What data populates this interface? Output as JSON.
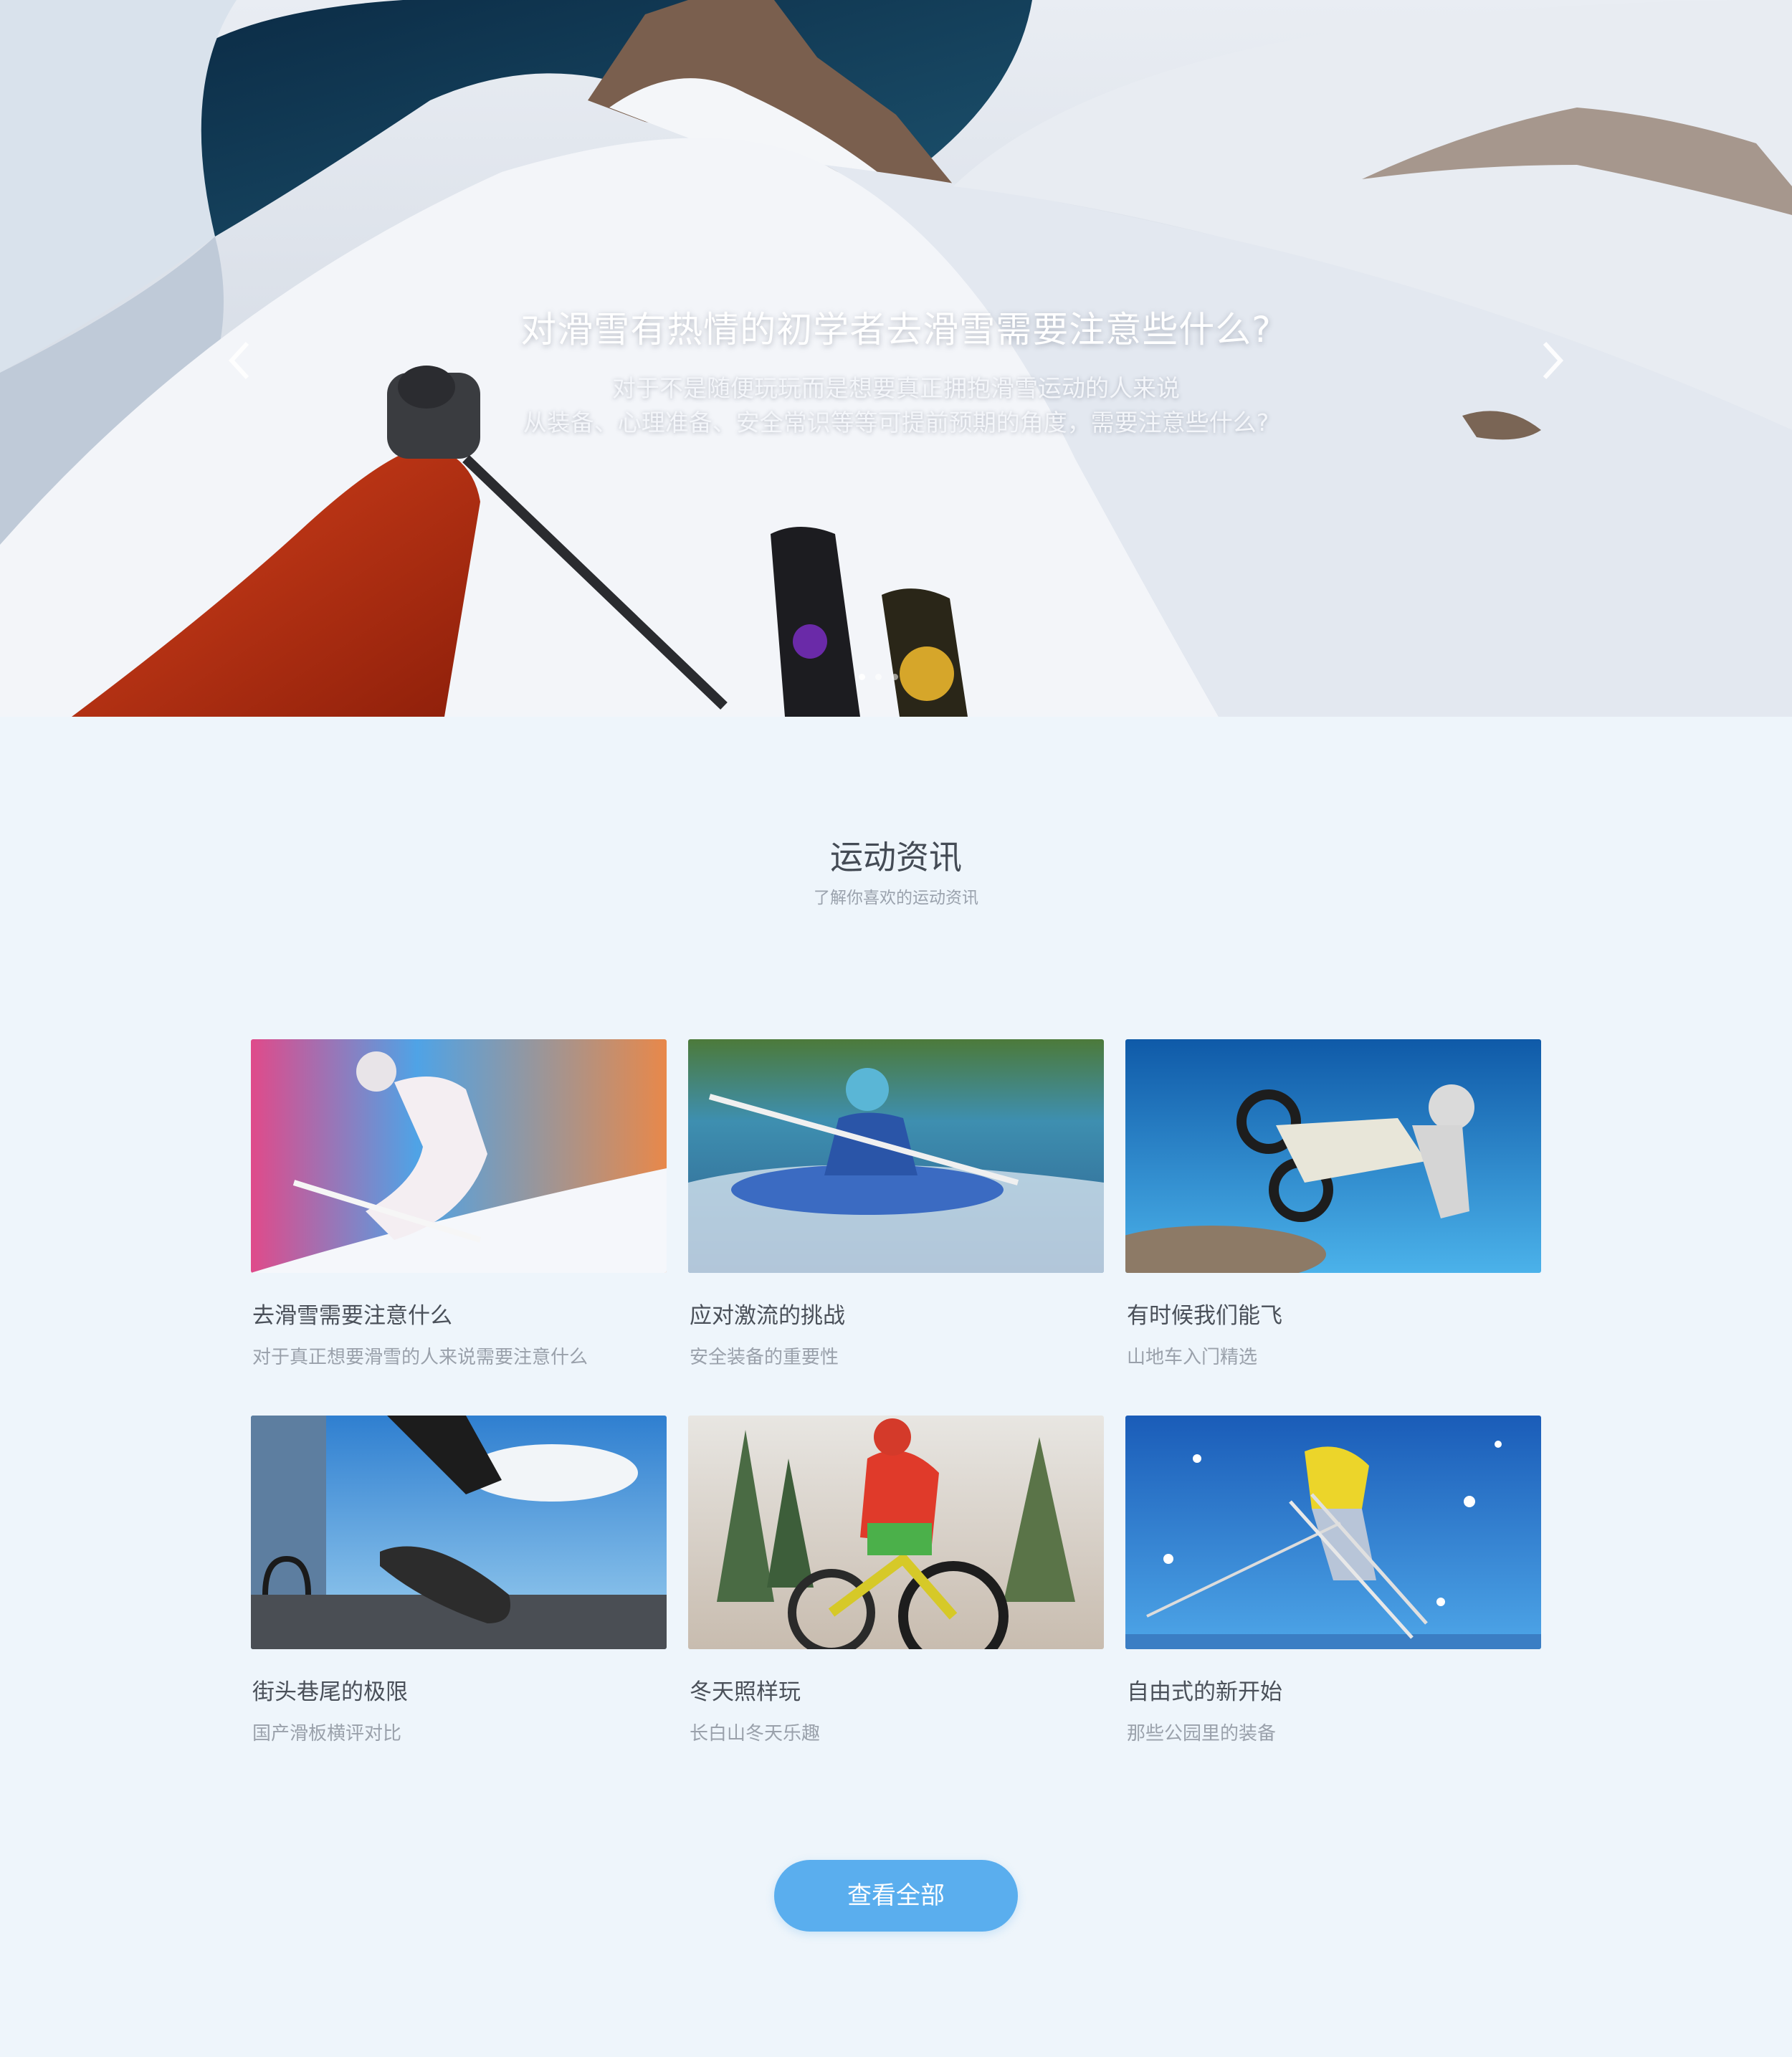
{
  "hero": {
    "title": "对滑雪有热情的初学者去滑雪需要注意些什么?",
    "subtitle_line1": "对于不是随便玩玩而是想要真正拥抱滑雪运动的人来说",
    "subtitle_line2": "从装备、心理准备、安全常识等等可提前预期的角度，需要注意些什么?",
    "prev_icon": "chevron-left-icon",
    "next_icon": "chevron-right-icon",
    "slide_count": 3,
    "active_slide": 1
  },
  "section": {
    "title": "运动资讯",
    "subtitle": "了解你喜欢的运动资讯"
  },
  "cards": [
    {
      "title": "去滑雪需要注意什么",
      "subtitle": "对于真正想要滑雪的人来说需要注意什么"
    },
    {
      "title": "应对激流的挑战",
      "subtitle": "安全装备的重要性"
    },
    {
      "title": "有时候我们能飞",
      "subtitle": "山地车入门精选"
    },
    {
      "title": "街头巷尾的极限",
      "subtitle": "国产滑板横评对比"
    },
    {
      "title": "冬天照样玩",
      "subtitle": "长白山冬天乐趣"
    },
    {
      "title": "自由式的新开始",
      "subtitle": "那些公园里的装备"
    }
  ],
  "view_all_label": "查看全部",
  "colors": {
    "page_bg": "#eef5fb",
    "button_bg": "#5aaeee",
    "title_text": "#444b55",
    "muted_text": "#9aa2ad"
  }
}
